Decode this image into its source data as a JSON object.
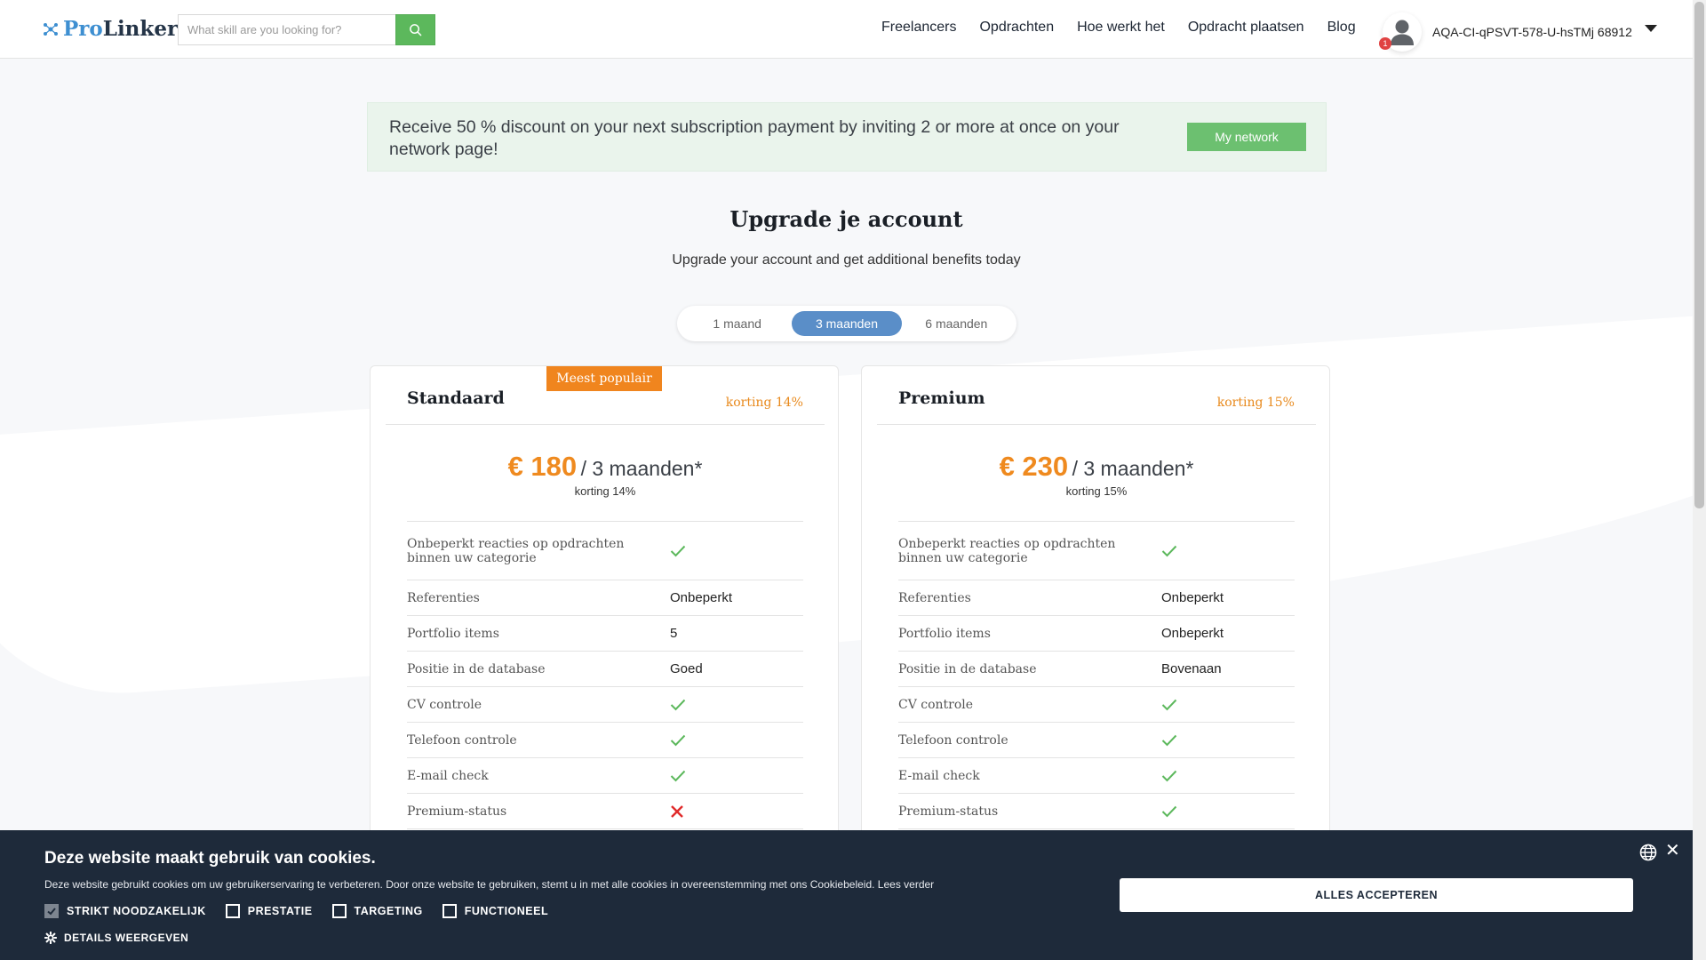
{
  "header": {
    "logo_pro": "Pro",
    "logo_linker": "Linker",
    "search_placeholder": "What skill are you looking for?",
    "nav": [
      "Freelancers",
      "Opdrachten",
      "Hoe werkt het",
      "Opdracht plaatsen",
      "Blog"
    ],
    "notification_count": "1",
    "username": "AQA-CI-qPSVT-578-U-hsTMj 68912"
  },
  "promo": {
    "text": "Receive 50 % discount on your next subscription payment by inviting 2 or more at once on your network page!",
    "button": "My network"
  },
  "page": {
    "title": "Upgrade je account",
    "subtitle": "Upgrade your account and get additional benefits today"
  },
  "period_toggle": {
    "options": [
      "1 maand",
      "3 maanden",
      "6 maanden"
    ],
    "selected": "3 maanden"
  },
  "plans": [
    {
      "name": "Standaard",
      "badge": "Meest populair",
      "discount_label": "korting 14%",
      "price": "€ 180",
      "period": "/ 3 maanden*",
      "price_sub": "korting 14%",
      "features": [
        {
          "name": "Onbeperkt reacties op opdrachten binnen uw categorie",
          "value": "check"
        },
        {
          "name": "Referenties",
          "value": "Onbeperkt"
        },
        {
          "name": "Portfolio items",
          "value": "5"
        },
        {
          "name": "Positie in de database",
          "value": "Goed"
        },
        {
          "name": "CV controle",
          "value": "check"
        },
        {
          "name": "Telefoon controle",
          "value": "check"
        },
        {
          "name": "E-mail check",
          "value": "check"
        },
        {
          "name": "Premium-status",
          "value": "cross"
        }
      ]
    },
    {
      "name": "Premium",
      "badge": "",
      "discount_label": "korting 15%",
      "price": "€ 230",
      "period": "/ 3 maanden*",
      "price_sub": "korting 15%",
      "features": [
        {
          "name": "Onbeperkt reacties op opdrachten binnen uw categorie",
          "value": "check"
        },
        {
          "name": "Referenties",
          "value": "Onbeperkt"
        },
        {
          "name": "Portfolio items",
          "value": "Onbeperkt"
        },
        {
          "name": "Positie in de database",
          "value": "Bovenaan"
        },
        {
          "name": "CV controle",
          "value": "check"
        },
        {
          "name": "Telefoon controle",
          "value": "check"
        },
        {
          "name": "E-mail check",
          "value": "check"
        },
        {
          "name": "Premium-status",
          "value": "check"
        }
      ]
    }
  ],
  "cookie": {
    "title": "Deze website maakt gebruik van cookies.",
    "text": "Deze website gebruikt cookies om uw gebruikerservaring te verbeteren. Door onze website te gebruiken, stemt u in met alle cookies in overeenstemming met ons Cookiebeleid. Lees verder",
    "options": [
      {
        "label": "STRIKT NOODZAKELIJK",
        "checked": true
      },
      {
        "label": "PRESTATIE",
        "checked": false
      },
      {
        "label": "TARGETING",
        "checked": false
      },
      {
        "label": "FUNCTIONEEL",
        "checked": false
      }
    ],
    "details": "DETAILS WEERGEVEN",
    "accept": "ALLES ACCEPTEREN",
    "close": "✕"
  },
  "colors": {
    "accent_green": "#5cb85c",
    "price_orange": "#ef8a1f",
    "toggle_blue": "#5a8ec8",
    "cookie_bg": "#1e2a3a",
    "cross_red": "#e02a2a"
  }
}
